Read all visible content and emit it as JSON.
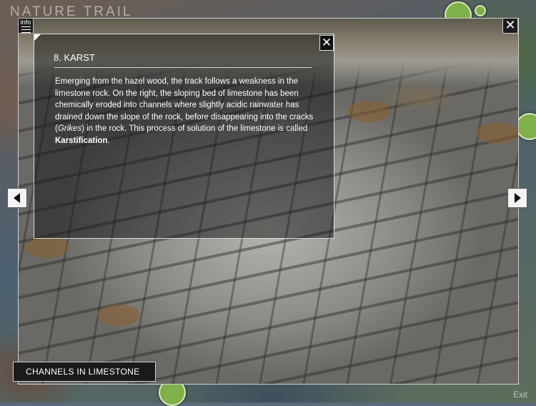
{
  "map": {
    "title": "NATURE TRAIL",
    "exit_label": "Exit",
    "marker_color": "#7fb04a"
  },
  "viewer": {
    "info_label": "info",
    "close_symbol": "✕",
    "prev_icon": "chevron-left-icon",
    "next_icon": "chevron-right-icon",
    "caption": "CHANNELS IN LIMESTONE"
  },
  "panel": {
    "close_symbol": "✕",
    "title": "8. KARST",
    "text_part1": "Emerging from the hazel wood, the track follows a weakness in the limestone rock. On the right, the sloping bed of limestone has been chemically eroded into channels where slightly acidic rainwater has drained down the slope of the rock, before disappearing into the cracks (",
    "text_italic": "Grikes",
    "text_part2": ") in the rock. This process of solution of the limestone is called ",
    "text_bold": "Karstification",
    "text_end": "."
  }
}
